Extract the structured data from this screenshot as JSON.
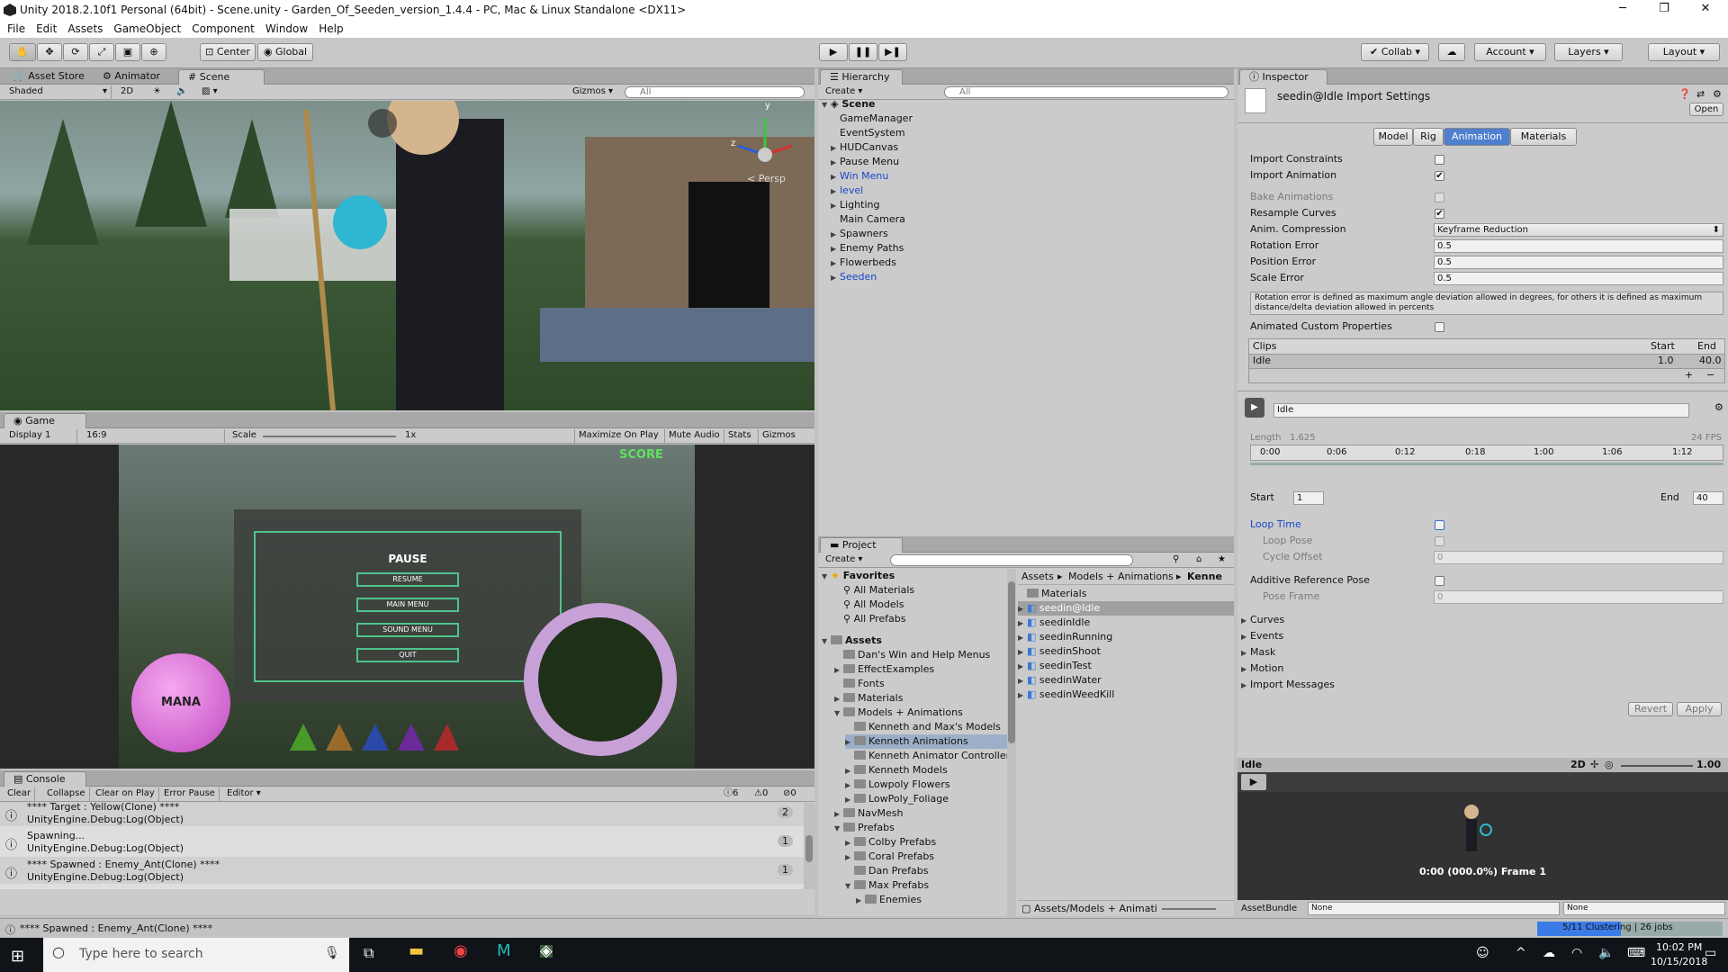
{
  "title_bar": {
    "title": "Unity 2018.2.10f1 Personal (64bit) - Scene.unity - Garden_Of_Seeden_version_1.4.4 - PC, Mac & Linux Standalone <DX11>",
    "minimize": "─",
    "maximize": "❐",
    "close": "✕"
  },
  "menu": [
    "File",
    "Edit",
    "Assets",
    "GameObject",
    "Component",
    "Window",
    "Help"
  ],
  "toolbar": {
    "center": "Center",
    "global": "Global",
    "collab": "Collab ▾",
    "account": "Account",
    "layers": "Layers",
    "layout": "Layout"
  },
  "scene_panel": {
    "tabs": [
      "Asset Store",
      "Animator",
      "Scene"
    ],
    "shaded": "Shaded",
    "mode_2d": "2D",
    "gizmos": "Gizmos",
    "search_placeholder": "All",
    "persp": "< Persp",
    "axis_y": "y",
    "axis_z": "z"
  },
  "game_panel": {
    "tab": "Game",
    "display": "Display 1",
    "aspect": "16:9",
    "scale_label": "Scale",
    "scale_value": "1x",
    "buttons": [
      "Maximize On Play",
      "Mute Audio",
      "Stats",
      "Gizmos"
    ],
    "score": "SCORE",
    "pause_title": "PAUSE",
    "pause_buttons": [
      "RESUME",
      "MAIN MENU",
      "SOUND MENU",
      "QUIT"
    ],
    "mana": "MANA"
  },
  "console": {
    "tab": "Console",
    "buttons": [
      "Clear",
      "Collapse",
      "Clear on Play",
      "Error Pause",
      "Editor"
    ],
    "counts": {
      "logs": "6",
      "warnings": "0",
      "errors": "0"
    },
    "entries": [
      {
        "line1": "**** Target : Yellow(Clone) ****",
        "line2": "UnityEngine.Debug:Log(Object)",
        "count": "2"
      },
      {
        "line1": "Spawning...",
        "line2": "UnityEngine.Debug:Log(Object)",
        "count": "1"
      },
      {
        "line1": "**** Spawned : Enemy_Ant(Clone) ****",
        "line2": "UnityEngine.Debug:Log(Object)",
        "count": "1"
      }
    ]
  },
  "status_bar": {
    "message": "**** Spawned : Enemy_Ant(Clone) ****",
    "progress_text": "5/11 Clustering | 26 jobs",
    "progress_fraction": 0.45
  },
  "hierarchy": {
    "tab": "Hierarchy",
    "create": "Create",
    "search_placeholder": "All",
    "scene": "Scene",
    "items": [
      {
        "label": "GameManager",
        "expandable": false,
        "blue": false
      },
      {
        "label": "EventSystem",
        "expandable": false,
        "blue": false
      },
      {
        "label": "HUDCanvas",
        "expandable": true,
        "blue": false
      },
      {
        "label": "Pause Menu",
        "expandable": true,
        "blue": false
      },
      {
        "label": "Win Menu",
        "expandable": true,
        "blue": true
      },
      {
        "label": "level",
        "expandable": true,
        "blue": true
      },
      {
        "label": "Lighting",
        "expandable": true,
        "blue": false
      },
      {
        "label": "Main Camera",
        "expandable": false,
        "blue": false
      },
      {
        "label": "Spawners",
        "expandable": true,
        "blue": false
      },
      {
        "label": "Enemy Paths",
        "expandable": true,
        "blue": false
      },
      {
        "label": "Flowerbeds",
        "expandable": true,
        "blue": false
      },
      {
        "label": "Seeden",
        "expandable": true,
        "blue": true
      }
    ]
  },
  "project": {
    "tab": "Project",
    "create": "Create",
    "favorites": "Favorites",
    "favorite_items": [
      "All Materials",
      "All Models",
      "All Prefabs"
    ],
    "assets": "Assets",
    "tree": [
      {
        "label": "Dan's Win and Help Menus",
        "indent": 1,
        "arrow": ""
      },
      {
        "label": "EffectExamples",
        "indent": 1,
        "arrow": "▶"
      },
      {
        "label": "Fonts",
        "indent": 1,
        "arrow": ""
      },
      {
        "label": "Materials",
        "indent": 1,
        "arrow": "▶"
      },
      {
        "label": "Models + Animations",
        "indent": 1,
        "arrow": "▼"
      },
      {
        "label": "Kenneth and Max's Models",
        "indent": 2,
        "arrow": ""
      },
      {
        "label": "Kenneth Animations",
        "indent": 2,
        "arrow": "▶",
        "selected": true
      },
      {
        "label": "Kenneth Animator Controllers",
        "indent": 2,
        "arrow": ""
      },
      {
        "label": "Kenneth Models",
        "indent": 2,
        "arrow": "▶"
      },
      {
        "label": "Lowpoly Flowers",
        "indent": 2,
        "arrow": "▶"
      },
      {
        "label": "LowPoly_Foliage",
        "indent": 2,
        "arrow": "▶"
      },
      {
        "label": "NavMesh",
        "indent": 1,
        "arrow": "▶"
      },
      {
        "label": "Prefabs",
        "indent": 1,
        "arrow": "▼"
      },
      {
        "label": "Colby Prefabs",
        "indent": 2,
        "arrow": "▶"
      },
      {
        "label": "Coral Prefabs",
        "indent": 2,
        "arrow": "▶"
      },
      {
        "label": "Dan Prefabs",
        "indent": 2,
        "arrow": ""
      },
      {
        "label": "Max Prefabs",
        "indent": 2,
        "arrow": "▼"
      },
      {
        "label": "Enemies",
        "indent": 3,
        "arrow": "▶"
      }
    ],
    "breadcrumb": [
      "Assets",
      "Models + Animations",
      "Kenne"
    ],
    "files": [
      {
        "label": "Materials",
        "folder": true
      },
      {
        "label": "seedin@Idle",
        "folder": false,
        "selected": true
      },
      {
        "label": "seedinIdle",
        "folder": false
      },
      {
        "label": "seedinRunning",
        "folder": false
      },
      {
        "label": "seedinShoot",
        "folder": false
      },
      {
        "label": "seedinTest",
        "folder": false
      },
      {
        "label": "seedinWater",
        "folder": false
      },
      {
        "label": "seedinWeedKill",
        "folder": false
      }
    ],
    "footer_path": "Assets/Models + Animati"
  },
  "inspector": {
    "tab": "Inspector",
    "title": "seedin@Idle Import Settings",
    "open": "Open",
    "tabs": [
      "Model",
      "Rig",
      "Animation",
      "Materials"
    ],
    "active_tab": "Animation",
    "rows": {
      "import_constraints": "Import Constraints",
      "import_animation": "Import Animation",
      "bake_animations": "Bake Animations",
      "resample_curves": "Resample Curves",
      "anim_compression": "Anim. Compression",
      "anim_compression_value": "Keyframe Reduction",
      "rotation_error": "Rotation Error",
      "rotation_error_value": "0.5",
      "position_error": "Position Error",
      "position_error_value": "0.5",
      "scale_error": "Scale Error",
      "scale_error_value": "0.5",
      "help_text": "Rotation error is defined as maximum angle deviation allowed in degrees, for others it is defined as maximum distance/delta deviation allowed in percents",
      "animated_custom": "Animated Custom Properties"
    },
    "clips": {
      "header": "Clips",
      "start_header": "Start",
      "end_header": "End",
      "name": "Idle",
      "start": "1.0",
      "end": "40.0",
      "plus": "+",
      "minus": "−"
    },
    "clip_editor": {
      "name": "Idle",
      "length_label": "Length",
      "length_value": "1.625",
      "fps": "24 FPS",
      "ticks": [
        "0:00",
        "0:06",
        "0:12",
        "0:18",
        "1:00",
        "1:06",
        "1:12"
      ],
      "start_label": "Start",
      "start_value": "1",
      "end_label": "End",
      "end_value": "40",
      "loop_time": "Loop Time",
      "loop_pose": "Loop Pose",
      "cycle_offset": "Cycle Offset",
      "cycle_offset_value": "0",
      "additive": "Additive Reference Pose",
      "pose_frame": "Pose Frame",
      "pose_frame_value": "0",
      "foldouts": [
        "Curves",
        "Events",
        "Mask",
        "Motion",
        "Import Messages"
      ],
      "revert": "Revert",
      "apply": "Apply"
    },
    "preview": {
      "name": "Idle",
      "mode_2d": "2D",
      "speed": "1.00",
      "frame_text": "0:00 (000.0%) Frame 1",
      "assetbundle_label": "AssetBundle",
      "assetbundle_value": "None",
      "variant_value": "None"
    }
  },
  "taskbar": {
    "search_placeholder": "Type here to search",
    "time": "10:02 PM",
    "date": "10/15/2018"
  }
}
